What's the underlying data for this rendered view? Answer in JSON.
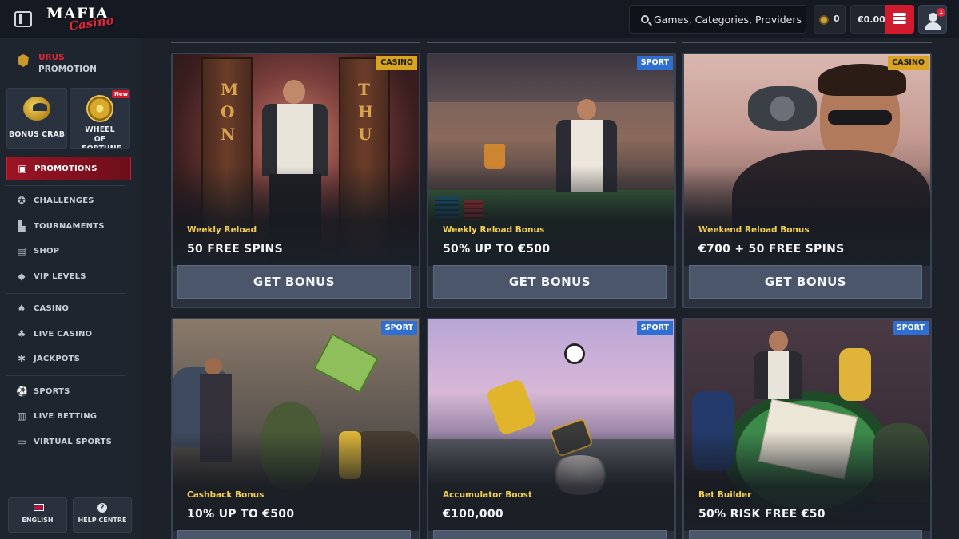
{
  "header": {
    "logo_main": "MAFIA",
    "logo_sub": "Casino",
    "search_placeholder": "Games, Categories, Providers",
    "coins": "0",
    "balance": "€0.00",
    "notifications": "1"
  },
  "sidebar": {
    "urus_title": "URUS",
    "urus_sub": "PROMOTION",
    "tiles": [
      {
        "label": "BONUS CRAB"
      },
      {
        "label": "WHEEL OF FORTUNE",
        "badge": "New"
      }
    ],
    "items": [
      {
        "label": "PROMOTIONS",
        "icon": "gift-icon"
      },
      {
        "label": "CHALLENGES",
        "icon": "badge-icon"
      },
      {
        "label": "TOURNAMENTS",
        "icon": "podium-icon"
      },
      {
        "label": "SHOP",
        "icon": "shop-icon"
      },
      {
        "label": "VIP LEVELS",
        "icon": "diamond-icon"
      },
      {
        "label": "CASINO",
        "icon": "spade-icon"
      },
      {
        "label": "LIVE CASINO",
        "icon": "club-icon"
      },
      {
        "label": "JACKPOTS",
        "icon": "gear-icon"
      },
      {
        "label": "SPORTS",
        "icon": "football-icon"
      },
      {
        "label": "LIVE BETTING",
        "icon": "stats-icon"
      },
      {
        "label": "VIRTUAL SPORTS",
        "icon": "monitor-icon"
      }
    ],
    "footer": {
      "language": "ENGLISH",
      "help": "HELP CENTRE"
    }
  },
  "colors": {
    "accent_red": "#d01a2d",
    "casino_tag": "#d9a520",
    "sport_tag": "#2f6fd1",
    "subtitle_gold": "#f2cf52"
  },
  "promotions": [
    {
      "tag": "CASINO",
      "subtitle": "Weekly Reload",
      "title": "50 FREE SPINS",
      "button": "GET BONUS",
      "door_left": "MON",
      "door_right": "THU"
    },
    {
      "tag": "SPORT",
      "subtitle": "Weekly Reload Bonus",
      "title": "50% UP TO €500",
      "button": "GET BONUS"
    },
    {
      "tag": "CASINO",
      "subtitle": "Weekend Reload Bonus",
      "title": "€700 + 50 FREE SPINS",
      "button": "GET BONUS"
    },
    {
      "tag": "SPORT",
      "subtitle": "Cashback Bonus",
      "title": "10% UP TO €500",
      "button": ""
    },
    {
      "tag": "SPORT",
      "subtitle": "Accumulator Boost",
      "title": "€100,000",
      "button": ""
    },
    {
      "tag": "SPORT",
      "subtitle": "Bet Builder",
      "title": "50% RISK FREE €50",
      "button": ""
    }
  ]
}
